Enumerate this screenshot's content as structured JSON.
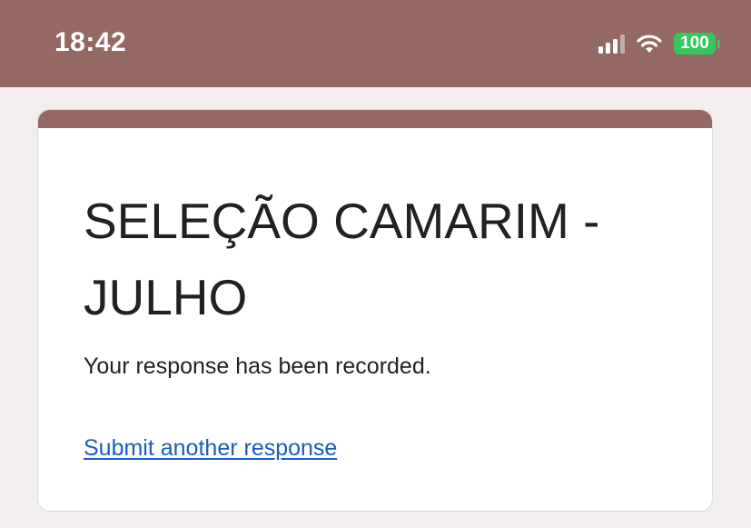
{
  "status_bar": {
    "time": "18:42",
    "battery": "100",
    "icons": [
      "signal-icon",
      "wifi-icon",
      "battery-icon"
    ],
    "background_color": "#956963"
  },
  "form": {
    "title": "SELEÇÃO CAMARIM - JULHO",
    "confirmation_message": "Your response has been recorded.",
    "submit_another_link": "Submit another response",
    "accent_color": "#956963",
    "link_color": "#1a5bc4"
  }
}
